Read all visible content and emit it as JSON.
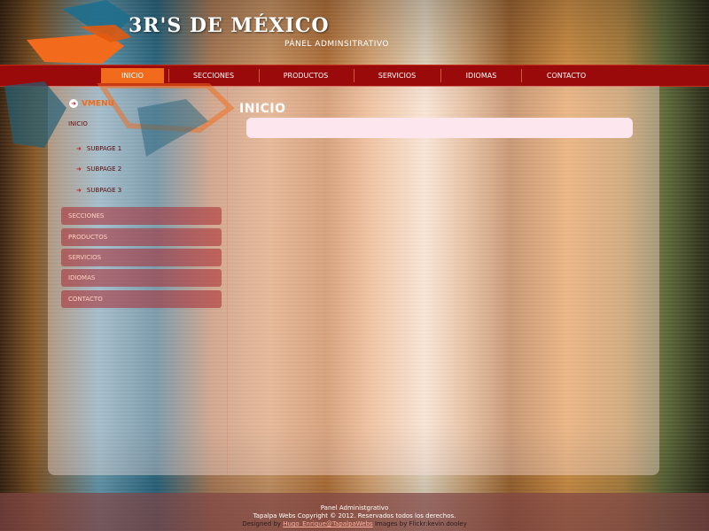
{
  "header": {
    "title": "3R'S DE MÉXICO",
    "subtitle": "PÁNEL ADMINSITRATIVO"
  },
  "topnav": {
    "items": [
      {
        "label": "INICIO",
        "active": true
      },
      {
        "label": "SECCIONES",
        "active": false
      },
      {
        "label": "PRODUCTOS",
        "active": false
      },
      {
        "label": "SERVICIOS",
        "active": false
      },
      {
        "label": "IDIOMAS",
        "active": false
      },
      {
        "label": "CONTACTO",
        "active": false
      }
    ]
  },
  "sidebar": {
    "title": "VMENU",
    "current": "INICIO",
    "subpages": [
      "SUBPAGE 1",
      "SUBPAGE 2",
      "SUBPAGE 3"
    ],
    "buttons": [
      "SECCIONES",
      "PRODUCTOS",
      "SERVICIOS",
      "IDIOMAS",
      "CONTACTO"
    ]
  },
  "content": {
    "title": "INICIO"
  },
  "footer": {
    "line1": "Panel Administgrativo",
    "line2": "Tapalpa Webs Copyright © 2012. Reservados todos los derechos.",
    "designed_by": "Designed by",
    "designer_link": "Hugo_Enrique@TapalpaWebs",
    "images_by": "Images by Flickr:kevin dooley"
  },
  "colors": {
    "nav_bg": "#9a0a0a",
    "nav_active": "#f26a1b",
    "accent_orange": "#f26a1b",
    "sidebar_button": "#aa2832",
    "content_box": "#fde6ee"
  }
}
